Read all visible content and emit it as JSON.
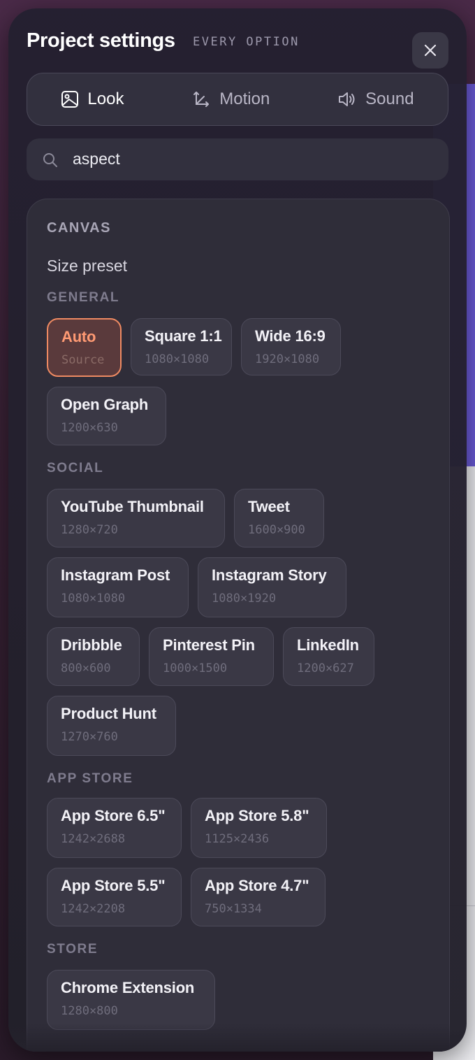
{
  "header": {
    "title": "Project settings",
    "subtitle": "EVERY OPTION",
    "close_icon": "close-icon"
  },
  "tabs": [
    {
      "label": "Look",
      "icon": "image-icon",
      "active": true
    },
    {
      "label": "Motion",
      "icon": "axes-icon",
      "active": false
    },
    {
      "label": "Sound",
      "icon": "speaker-icon",
      "active": false
    }
  ],
  "search": {
    "value": "aspect",
    "icon": "search-icon"
  },
  "canvas": {
    "section_title": "CANVAS",
    "field_label": "Size preset",
    "groups": {
      "general": {
        "label": "GENERAL",
        "presets": [
          {
            "name": "Auto",
            "dims": "Source",
            "selected": true
          },
          {
            "name": "Square 1:1",
            "dims": "1080×1080"
          },
          {
            "name": "Wide 16:9",
            "dims": "1920×1080"
          },
          {
            "name": "Open Graph",
            "dims": "1200×630"
          }
        ]
      },
      "social": {
        "label": "SOCIAL",
        "presets": [
          {
            "name": "YouTube Thumbnail",
            "dims": "1280×720"
          },
          {
            "name": "Tweet",
            "dims": "1600×900"
          },
          {
            "name": "Instagram Post",
            "dims": "1080×1080"
          },
          {
            "name": "Instagram Story",
            "dims": "1080×1920"
          },
          {
            "name": "Dribbble",
            "dims": "800×600"
          },
          {
            "name": "Pinterest Pin",
            "dims": "1000×1500"
          },
          {
            "name": "LinkedIn",
            "dims": "1200×627"
          },
          {
            "name": "Product Hunt",
            "dims": "1270×760"
          }
        ]
      },
      "app_store": {
        "label": "APP STORE",
        "presets": [
          {
            "name": "App Store 6.5\"",
            "dims": "1242×2688"
          },
          {
            "name": "App Store 5.8\"",
            "dims": "1125×2436"
          },
          {
            "name": "App Store 5.5\"",
            "dims": "1242×2208"
          },
          {
            "name": "App Store 4.7\"",
            "dims": "750×1334"
          }
        ]
      },
      "store": {
        "label": "STORE",
        "presets": [
          {
            "name": "Chrome Extension",
            "dims": "1280×800"
          }
        ]
      }
    }
  },
  "colors": {
    "accent": "#ef8a62",
    "panel": "#24202f"
  }
}
